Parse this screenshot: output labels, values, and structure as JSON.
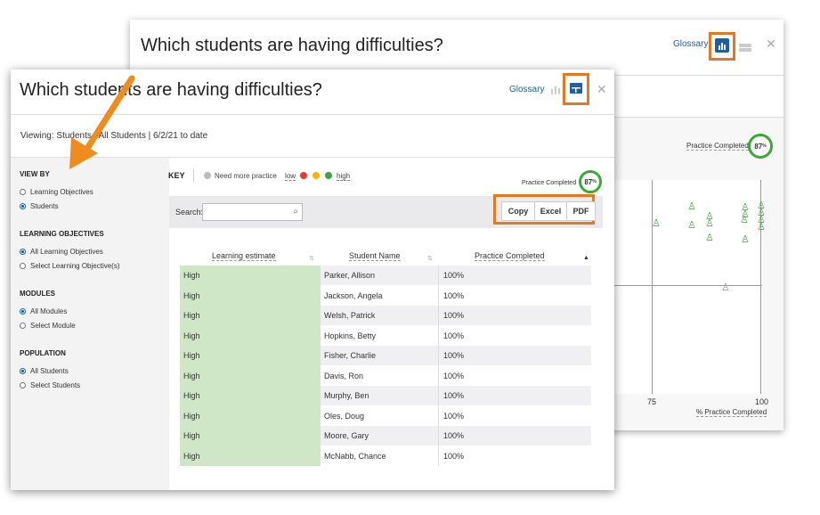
{
  "back_panel": {
    "title": "Which students are having difficulties?",
    "glossary": "Glossary",
    "practice_label": "Practice Completed",
    "practice_pct": "87",
    "practice_pct_suffix": "%",
    "axis_ticks": [
      "75",
      "100"
    ],
    "xlabel": "% Practice Completed"
  },
  "front_panel": {
    "title": "Which students are having difficulties?",
    "glossary": "Glossary",
    "viewing": "Viewing: Students | All Students | 6/2/21 to date",
    "sidebar": {
      "view_by": {
        "heading": "VIEW BY",
        "options": [
          "Learning Objectives",
          "Students"
        ],
        "selected": 1
      },
      "learning_objectives": {
        "heading": "LEARNING OBJECTIVES",
        "options": [
          "All Learning Objectives",
          "Select Learning Objective(s)"
        ],
        "selected": 0
      },
      "modules": {
        "heading": "MODULES",
        "options": [
          "All Modules",
          "Select Module"
        ],
        "selected": 0
      },
      "population": {
        "heading": "POPULATION",
        "options": [
          "All Students",
          "Select Students"
        ],
        "selected": 0
      }
    },
    "key": {
      "label": "KEY",
      "need_more": "Need more practice",
      "low": "low",
      "high": "high",
      "colors": {
        "need_more": "#bdbdbd",
        "red": "#e53935",
        "yellow": "#f4b400",
        "green": "#43a047"
      }
    },
    "practice_label": "Practice Completed",
    "practice_pct": "87",
    "practice_pct_suffix": "%",
    "search_label": "Search:",
    "export_buttons": [
      "Copy",
      "Excel",
      "PDF"
    ],
    "table": {
      "headers": [
        "Learning estimate",
        "Student Name",
        "Practice Completed"
      ],
      "rows": [
        [
          "High",
          "Parker, Allison",
          "100%"
        ],
        [
          "High",
          "Jackson, Angela",
          "100%"
        ],
        [
          "High",
          "Welsh, Patrick",
          "100%"
        ],
        [
          "High",
          "Hopkins, Betty",
          "100%"
        ],
        [
          "High",
          "Fisher, Charlie",
          "100%"
        ],
        [
          "High",
          "Davis, Ron",
          "100%"
        ],
        [
          "High",
          "Murphy, Ben",
          "100%"
        ],
        [
          "High",
          "Oles, Doug",
          "100%"
        ],
        [
          "High",
          "Moore, Gary",
          "100%"
        ],
        [
          "High",
          "McNabb, Chance",
          "100%"
        ]
      ]
    }
  },
  "colors": {
    "accent_orange": "#e87722",
    "link_blue": "#1a5fa8",
    "estimate_green": "#cfe7c7",
    "ring_green": "#3aaa35"
  }
}
